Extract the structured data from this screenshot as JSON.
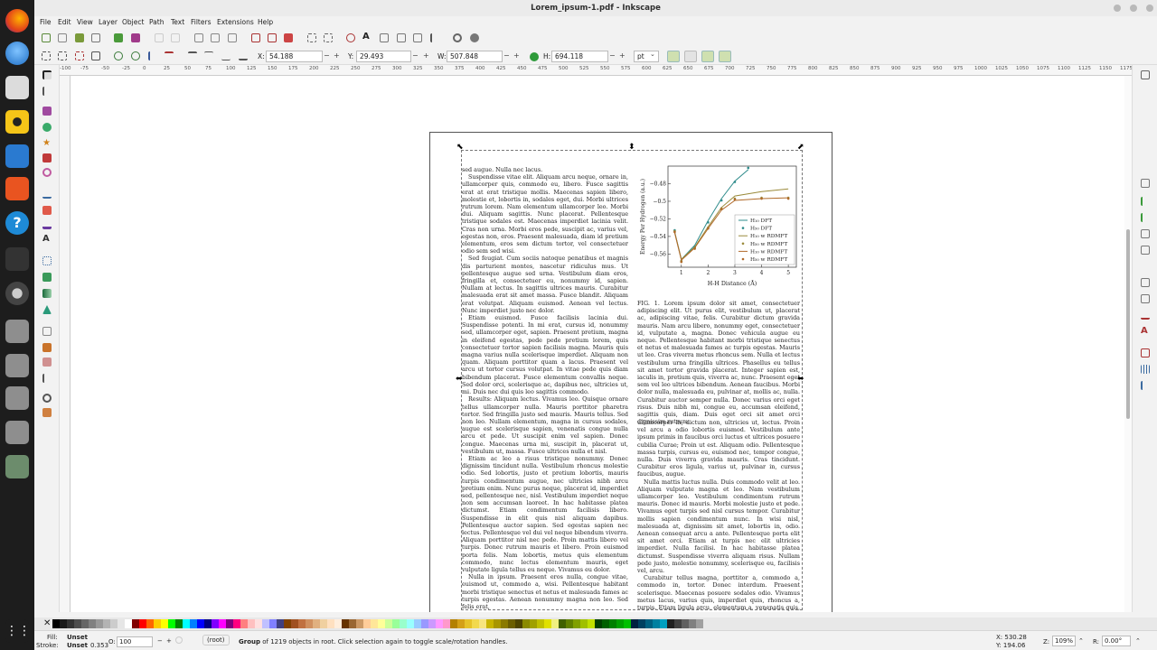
{
  "window": {
    "title": "Lorem_ipsum-1.pdf - Inkscape"
  },
  "menubar": [
    "File",
    "Edit",
    "View",
    "Layer",
    "Object",
    "Path",
    "Text",
    "Filters",
    "Extensions",
    "Help"
  ],
  "controls": {
    "x_label": "X:",
    "x_value": "54.188",
    "y_label": "Y:",
    "y_value": "29.493",
    "w_label": "W:",
    "w_value": "507.848",
    "h_label": "H:",
    "h_value": "694.118",
    "unit": "pt"
  },
  "ruler_ticks": [
    "-100",
    "-75",
    "-50",
    "-25",
    "0",
    "25",
    "50",
    "75",
    "100",
    "125",
    "150",
    "175",
    "200",
    "225",
    "250",
    "275",
    "300",
    "325",
    "350",
    "375",
    "400",
    "425",
    "450",
    "475",
    "500",
    "525",
    "550",
    "575",
    "600",
    "625",
    "650",
    "675",
    "700",
    "725",
    "750",
    "775",
    "800",
    "825",
    "850",
    "875",
    "900",
    "925",
    "950",
    "975",
    "1000",
    "1025",
    "1050",
    "1075",
    "1100",
    "1125",
    "1150",
    "1175"
  ],
  "document": {
    "left_column": [
      {
        "text": "sed augue. Nulla nec lacus.",
        "indent": false
      },
      {
        "text": "Suspendisse vitae elit. Aliquam arcu neque, ornare in, ullamcorper quis, commodo eu, libero. Fusce sagittis erat at erat tristique mollis. Maecenas sapien libero, molestie et, lobortis in, sodales eget, dui. Morbi ultrices rutrum lorem. Nam elementum ullamcorper leo. Morbi dui. Aliquam sagittis. Nunc placerat. Pellentesque tristique sodales est. Maecenas imperdiet lacinia velit. Cras non urna. Morbi eros pede, suscipit ac, varius vel, egestas non, eros. Praesent malesuada, diam id pretium elementum, eros sem dictum tortor, vel consectetuer odio sem sed wisi.",
        "indent": true
      },
      {
        "text": "Sed feugiat. Cum sociis natoque penatibus et magnis dis parturient montes, nascetur ridiculus mus. Ut pellentesque augue sed urna. Vestibulum diam eros, fringilla et, consectetuer eu, nonummy id, sapien. Nullam at lectus. In sagittis ultrices mauris. Curabitur malesuada erat sit amet massa. Fusce blandit. Aliquam erat volutpat. Aliquam euismod. Aenean vel lectus. Nunc imperdiet justo nec dolor.",
        "indent": true
      },
      {
        "text": "Etiam euismod. Fusce facilisis lacinia dui. Suspendisse potenti. In mi erat, cursus id, nonummy sed, ullamcorper eget, sapien. Praesent pretium, magna in eleifend egestas, pede pede pretium lorem, quis consectetuer tortor sapien facilisis magna. Mauris quis magna varius nulla scelerisque imperdiet. Aliquam non quam. Aliquam porttitor quam a lacus. Praesent vel arcu ut tortor cursus volutpat. In vitae pede quis diam bibendum placerat. Fusce elementum convallis neque. Sed dolor orci, scelerisque ac, dapibus nec, ultricies ut, mi. Duis nec dui quis leo sagittis commodo.",
        "indent": true
      },
      {
        "text": "Results: Aliquam lectus. Vivamus leo. Quisque ornare tellus ullamcorper nulla. Mauris porttitor pharetra tortor. Sed fringilla justo sed mauris. Mauris tellus. Sed non leo. Nullam elementum, magna in cursus sodales, augue est scelerisque sapien, venenatis congue nulla arcu et pede. Ut suscipit enim vel sapien. Donec congue. Maecenas urna mi, suscipit in, placerat ut, vestibulum ut, massa. Fusce ultrices nulla et nisl.",
        "indent": true
      },
      {
        "text": "Etiam ac leo a risus tristique nonummy. Donec dignissim tincidunt nulla. Vestibulum rhoncus molestie odio. Sed lobortis, justo et pretium lobortis, mauris turpis condimentum augue, nec ultricies nibh arcu pretium enim. Nunc purus neque, placerat id, imperdiet sed, pellentesque nec, nisl. Vestibulum imperdiet neque non sem accumsan laoreet. In hac habitasse platea dictumst. Etiam condimentum facilisis libero. Suspendisse in elit quis nisl aliquam dapibus. Pellentesque auctor sapien. Sed egestas sapien nec lectus. Pellentesque vel dui vel neque bibendum viverra. Aliquam porttitor nisl nec pede. Proin mattis libero vel turpis. Donec rutrum mauris et libero. Proin euismod porta felis. Nam lobortis, metus quis elementum commodo, nunc lectus elementum mauris, eget vulputate ligula tellus eu neque. Vivamus eu dolor.",
        "indent": true
      },
      {
        "text": "Nulla in ipsum. Praesent eros nulla, congue vitae, euismod ut, commodo a, wisi. Pellentesque habitant morbi tristique senectus et netus et malesuada fames ac turpis egestas. Aenean nonummy magna non leo. Sed felis erat,",
        "indent": true
      }
    ],
    "caption": "FIG. 1. Lorem ipsum dolor sit amet, consectetuer adipiscing elit. Ut purus elit, vestibulum ut, placerat ac, adipiscing vitae, felis. Curabitur dictum gravida mauris. Nam arcu libero, nonummy eget, consectetuer id, vulputate a, magna. Donec vehicula augue eu neque. Pellentesque habitant morbi tristique senectus et netus et malesuada fames ac turpis egestas. Mauris ut leo. Cras viverra metus rhoncus sem. Nulla et lectus vestibulum urna fringilla ultrices. Phasellus eu tellus sit amet tortor gravida placerat. Integer sapien est, iaculis in, pretium quis, viverra ac, nunc. Praesent eget sem vel leo ultrices bibendum. Aenean faucibus. Morbi dolor nulla, malesuada eu, pulvinar at, mollis ac, nulla. Curabitur auctor semper nulla. Donec varius orci eget risus. Duis nibh mi, congue eu, accumsan eleifend, sagittis quis, diam. Duis eget orci sit amet orci dignissim rutrum.",
    "right_column": [
      {
        "text": "ullamcorper in, dictum non, ultricies ut, lectus. Proin vel arcu a odio lobortis euismod. Vestibulum ante ipsum primis in faucibus orci luctus et ultrices posuere cubilia Curae; Proin ut est. Aliquam odio. Pellentesque massa turpis, cursus eu, euismod nec, tempor congue, nulla. Duis viverra gravida mauris. Cras tincidunt. Curabitur eros ligula, varius ut, pulvinar in, cursus faucibus, augue.",
        "indent": false
      },
      {
        "text": "Nulla mattis luctus nulla. Duis commodo velit at leo. Aliquam vulputate magna et leo. Nam vestibulum ullamcorper leo. Vestibulum condimentum rutrum mauris. Donec id mauris. Morbi molestie justo et pede. Vivamus eget turpis sed nisl cursus tempor. Curabitur mollis sapien condimentum nunc. In wisi nisl, malesuada at, dignissim sit amet, lobortis in, odio. Aenean consequat arcu a ante. Pellentesque porta elit sit amet orci. Etiam at turpis nec elit ultricies imperdiet. Nulla facilisi. In hac habitasse platea dictumst. Suspendisse viverra aliquam risus. Nullam pede justo, molestie nonummy, scelerisque eu, facilisis vel, arcu.",
        "indent": true
      },
      {
        "text": "Curabitur tellus magna, porttitor a, commodo a, commodo in, tortor. Donec interdum. Praesent scelerisque. Maecenas posuere sodales odio. Vivamus metus lacus, varius quis, imperdiet quis, rhoncus a, turpis. Etiam ligula arcu, elementum a, venenatis quis, sollicitudin sed, metus. Donec nunc pede, tincidunt in, venenatis vitae,",
        "indent": true
      }
    ]
  },
  "chart_data": {
    "type": "line",
    "xlabel": "H-H Distance (Å)",
    "ylabel": "Energy Per Hydrogen (a.u.)",
    "xlim": [
      0.5,
      5.3
    ],
    "ylim": [
      -0.575,
      -0.46
    ],
    "xticks": [
      "1",
      "2",
      "3",
      "4",
      "5"
    ],
    "yticks": [
      "-0.48",
      "-0.5",
      "-0.52",
      "-0.54",
      "-0.56"
    ],
    "legend_position": "lower-right",
    "series": [
      {
        "name": "H₁₀ DFT",
        "style": "line",
        "color": "#2e8b8b",
        "x": [
          0.75,
          1.0,
          1.5,
          2.0,
          2.5,
          3.0,
          3.5
        ],
        "y": [
          -0.535,
          -0.566,
          -0.55,
          -0.522,
          -0.497,
          -0.477,
          -0.464
        ]
      },
      {
        "name": "H₅₀ DFT",
        "style": "points",
        "color": "#2e8b8b",
        "x": [
          0.75,
          1.0,
          1.5,
          2.0,
          2.5,
          3.0,
          3.5
        ],
        "y": [
          -0.533,
          -0.568,
          -0.552,
          -0.524,
          -0.499,
          -0.478,
          -0.462
        ]
      },
      {
        "name": "H₁₀ w RDMFT",
        "style": "line",
        "color": "#9a8a3a",
        "x": [
          0.75,
          1.0,
          1.5,
          2.0,
          2.5,
          3.0,
          4.0,
          5.0
        ],
        "y": [
          -0.535,
          -0.566,
          -0.552,
          -0.529,
          -0.507,
          -0.494,
          -0.489,
          -0.486
        ]
      },
      {
        "name": "H₅₀ w RDMFT",
        "style": "points",
        "color": "#9a8a3a",
        "x": [
          0.75,
          1.0,
          1.5,
          2.0,
          2.5,
          3.0,
          4.0,
          5.0
        ],
        "y": [
          -0.534,
          -0.568,
          -0.553,
          -0.53,
          -0.508,
          -0.497,
          -0.496,
          -0.496
        ]
      },
      {
        "name": "H₁₀ w RDMFT",
        "style": "line",
        "color": "#b06a2a",
        "x": [
          0.75,
          1.0,
          1.5,
          2.0,
          2.5,
          3.0,
          4.0,
          5.0
        ],
        "y": [
          -0.536,
          -0.567,
          -0.553,
          -0.531,
          -0.51,
          -0.499,
          -0.497,
          -0.496
        ]
      },
      {
        "name": "H₅₀ w RDMFT",
        "style": "points",
        "color": "#b06a2a",
        "x": [
          0.75,
          1.0,
          1.5,
          2.0,
          2.5,
          3.0,
          4.0,
          5.0
        ],
        "y": [
          -0.535,
          -0.569,
          -0.554,
          -0.531,
          -0.509,
          -0.498,
          -0.497,
          -0.497
        ]
      }
    ]
  },
  "status": {
    "fill_label": "Fill:",
    "fill_value": "Unset",
    "stroke_label": "Stroke:",
    "stroke_value": "Unset",
    "stroke_width": "0.353",
    "opacity_label": "O:",
    "opacity_value": "100",
    "layer": "(root)",
    "msg_prefix": "Group",
    "msg_rest": " of 1219 objects in root. Click selection again to toggle scale/rotation handles.",
    "x_coord": "X: 530.28",
    "y_coord": "Y: 194.06",
    "z_label": "Z:",
    "zoom": "109%",
    "r_label": "R:",
    "rotation": "0.00°"
  },
  "palette": [
    "#000000",
    "#1a1a1a",
    "#333333",
    "#4d4d4d",
    "#666666",
    "#808080",
    "#999999",
    "#b3b3b3",
    "#cccccc",
    "#e6e6e6",
    "#ffffff",
    "#800000",
    "#ff0000",
    "#ff6600",
    "#ffcc00",
    "#ffff00",
    "#00ff00",
    "#008000",
    "#00ffff",
    "#0080ff",
    "#0000ff",
    "#000080",
    "#8000ff",
    "#ff00ff",
    "#800080",
    "#ff0080",
    "#ff8080",
    "#ffc0c0",
    "#ffe0e0",
    "#c0c0ff",
    "#8080ff",
    "#404080",
    "#804000",
    "#a05020",
    "#c07040",
    "#d09060",
    "#e0b080",
    "#f0d0a0",
    "#ffe0c0",
    "#ffeedd",
    "#663300",
    "#996633",
    "#cc9966",
    "#ffcc99",
    "#ffe699",
    "#ffff99",
    "#ccff99",
    "#99ff99",
    "#99ffcc",
    "#99ffff",
    "#99ccff",
    "#9999ff",
    "#cc99ff",
    "#ff99ff",
    "#ff99cc",
    "#b38000",
    "#d4a017",
    "#e6c229",
    "#f2d94e",
    "#f7e57f",
    "#c8b400",
    "#a89600",
    "#8a7a00",
    "#6b5e00",
    "#4d4400",
    "#8a8a00",
    "#a0a000",
    "#c0c000",
    "#e0e000",
    "#f0f080",
    "#406000",
    "#608000",
    "#80a000",
    "#a0c000",
    "#c0e000",
    "#004000",
    "#006000",
    "#008000",
    "#00a000",
    "#00c000",
    "#002040",
    "#004060",
    "#006080",
    "#0080a0",
    "#00a0c0",
    "#202020",
    "#404040",
    "#606060",
    "#808080",
    "#a0a0a0"
  ]
}
